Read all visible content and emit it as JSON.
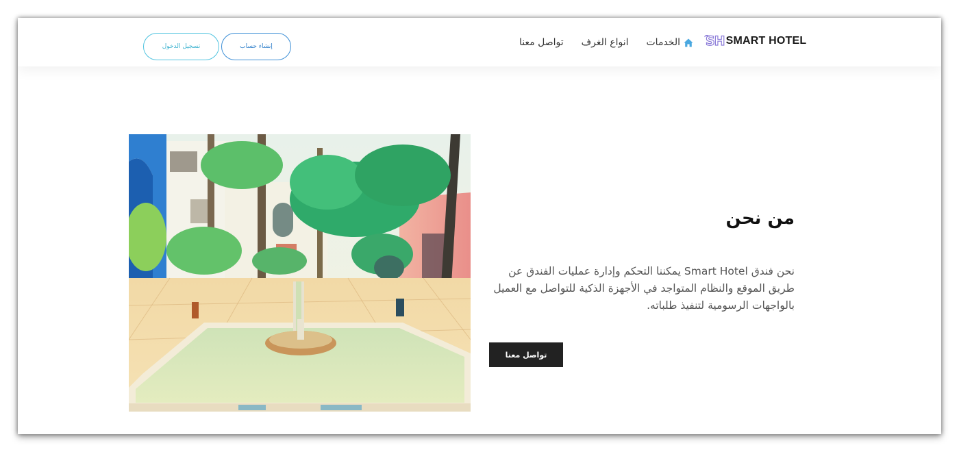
{
  "brand": {
    "logo_mark": "SH",
    "logo_text": "SMART HOTEL"
  },
  "nav": {
    "items": [
      {
        "label": "الخدمات",
        "icon": "home-icon"
      },
      {
        "label": "انواع الغرف"
      },
      {
        "label": "تواصل معنا"
      }
    ],
    "signup_label": "إنشاء حساب",
    "login_label": "تسجيل الدخول"
  },
  "about": {
    "title": "من نحن",
    "text": "نحن فندق Smart Hotel يمكننا التحكم وإدارة عمليات الفندق عن طريق الموقع والنظام المتواجد في الأجهزة الذكية للتواصل مع العميل بالواجهات الرسومية لتنفيذ طلباته.",
    "button_label": "تواصل معنا"
  },
  "colors": {
    "logo_accent": "#8b7bd8",
    "home_icon": "#4aa8e0",
    "login_border": "#4fc3df",
    "signup_border": "#3d8fd6",
    "contact_button_bg": "#222222"
  }
}
